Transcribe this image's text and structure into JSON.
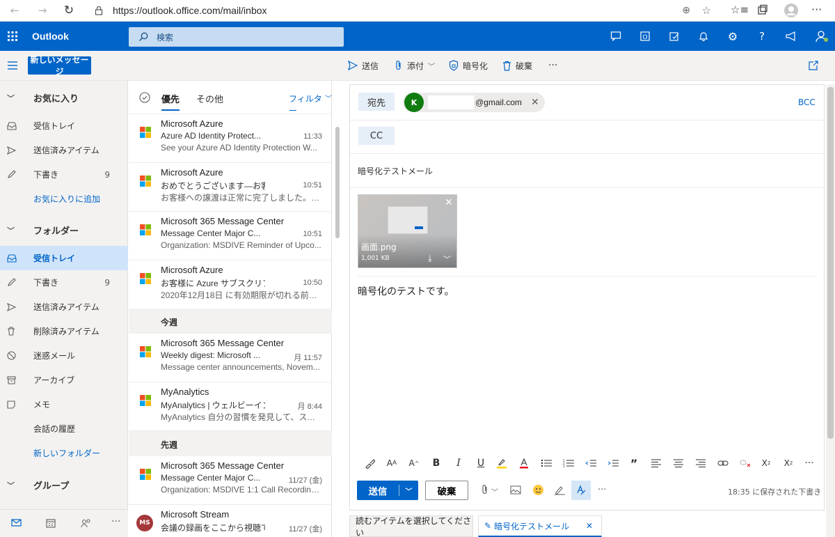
{
  "browser": {
    "url": "https://outlook.office.com/mail/inbox"
  },
  "suite": {
    "app_name": "Outlook",
    "search_placeholder": "検索"
  },
  "commands": {
    "new_message": "新しいメッセージ",
    "send": "送信",
    "attach": "添付",
    "encrypt": "暗号化",
    "discard": "破棄",
    "more": "···"
  },
  "nav": {
    "favorites_header": "お気に入り",
    "favorites": [
      {
        "label": "受信トレイ",
        "count": ""
      },
      {
        "label": "送信済みアイテム",
        "count": ""
      },
      {
        "label": "下書き",
        "count": "9"
      }
    ],
    "add_favorite": "お気に入りに追加",
    "folders_header": "フォルダー",
    "folders": [
      {
        "label": "受信トレイ",
        "count": ""
      },
      {
        "label": "下書き",
        "count": "9"
      },
      {
        "label": "送信済みアイテム",
        "count": ""
      },
      {
        "label": "削除済みアイテム",
        "count": ""
      },
      {
        "label": "迷惑メール",
        "count": ""
      },
      {
        "label": "アーカイブ",
        "count": ""
      },
      {
        "label": "メモ",
        "count": ""
      },
      {
        "label": "会話の履歴",
        "count": ""
      }
    ],
    "new_folder": "新しいフォルダー",
    "groups_header": "グループ"
  },
  "list": {
    "tab_focused": "優先",
    "tab_other": "その他",
    "filter": "フィルター",
    "messages_top": [
      {
        "from": "Microsoft Azure",
        "subject": "Azure AD Identity Protect...",
        "time": "11:33",
        "preview": "See your Azure AD Identity Protection W..."
      },
      {
        "from": "Microsoft Azure",
        "subject": "おめでとうございます—お客...",
        "time": "10:51",
        "preview": "お客様への譲渡は正常に完了しました。Azur..."
      },
      {
        "from": "Microsoft 365 Message Center",
        "subject": "Message Center Major C...",
        "time": "10:51",
        "preview": "Organization: MSDIVE Reminder of Upco..."
      },
      {
        "from": "Microsoft Azure",
        "subject": "お客様に Azure サブスクリプ...",
        "time": "10:50",
        "preview": "2020年12月18日 に有効期限が切れる前に..."
      }
    ],
    "section_week": "今週",
    "messages_week": [
      {
        "from": "Microsoft 365 Message Center",
        "subject": "Weekly digest: Microsoft ...",
        "time": "月 11:57",
        "preview": "Message center announcements, Novem..."
      },
      {
        "from": "MyAnalytics",
        "subject": "MyAnalytics | ウェルビーイン...",
        "time": "月 8:44",
        "preview": "MyAnalytics 自分の習慣を発見して、スマート..."
      }
    ],
    "section_lastweek": "先週",
    "messages_lastweek": [
      {
        "from": "Microsoft 365 Message Center",
        "subject": "Message Center Major C...",
        "time": "11/27 (金)",
        "preview": "Organization: MSDIVE 1:1 Call Recording..."
      },
      {
        "from": "Microsoft Stream",
        "subject": "会議の録画をここから視聴で...",
        "time": "11/27 (金)",
        "preview": "",
        "avatar": "MS"
      }
    ]
  },
  "compose": {
    "to_label": "宛先",
    "recipient_initial": "K",
    "recipient_email": "@gmail.com",
    "bcc": "BCC",
    "cc_label": "CC",
    "subject": "暗号化テストメール",
    "attachment_name": "画面.png",
    "attachment_size": "1,001 KB",
    "body": "暗号化のテストです。",
    "send": "送信",
    "discard": "破棄",
    "saved_status": "18:35 に保存された下書き"
  },
  "bottom_tabs": {
    "reading": "読むアイテムを選択してください",
    "draft": "暗号化テストメール"
  },
  "colors": {
    "brand": "#0064c8",
    "nav_bg": "#f3f2f1",
    "active_bg": "#cfe4fa",
    "avatar_green": "#107c10",
    "stream_avatar": "#a4373a"
  }
}
